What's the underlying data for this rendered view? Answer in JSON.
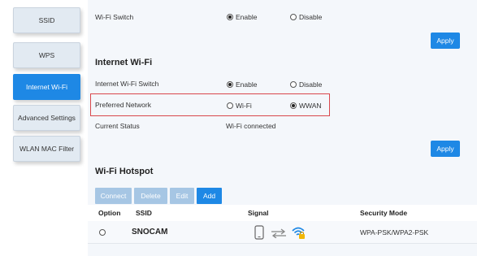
{
  "sidebar": {
    "items": [
      {
        "label": "SSID",
        "active": false
      },
      {
        "label": "WPS",
        "active": false
      },
      {
        "label": "Internet Wi-Fi",
        "active": true
      },
      {
        "label": "Advanced Settings",
        "active": false
      },
      {
        "label": "WLAN MAC Filter",
        "active": false
      }
    ]
  },
  "wifi_section": {
    "switch_label": "Wi-Fi Switch",
    "enable_label": "Enable",
    "disable_label": "Disable",
    "selected": "Enable",
    "apply_label": "Apply"
  },
  "internet_wifi": {
    "title": "Internet Wi-Fi",
    "switch_label": "Internet Wi-Fi Switch",
    "enable_label": "Enable",
    "disable_label": "Disable",
    "switch_selected": "Enable",
    "preferred_label": "Preferred Network",
    "opt_wifi": "Wi-Fi",
    "opt_wwan": "WWAN",
    "preferred_selected": "WWAN",
    "status_label": "Current Status",
    "status_value": "Wi-Fi connected",
    "apply_label": "Apply"
  },
  "hotspot": {
    "title": "Wi-Fi Hotspot",
    "buttons": {
      "connect": "Connect",
      "delete": "Delete",
      "edit": "Edit",
      "add": "Add"
    },
    "columns": {
      "option": "Option",
      "ssid": "SSID",
      "signal": "Signal",
      "security": "Security Mode"
    },
    "rows": [
      {
        "ssid": "SNOCAM",
        "security": "WPA-PSK/WPA2-PSK"
      }
    ]
  },
  "colors": {
    "accent": "#1e88e5",
    "highlight": "#d9474c",
    "disabled_button": "#a6c6e4",
    "panel_bg": "#f4f7fb"
  }
}
